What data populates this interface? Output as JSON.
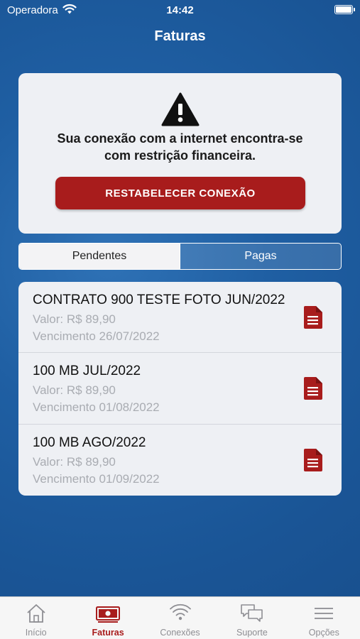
{
  "status_bar": {
    "carrier": "Operadora",
    "time": "14:42"
  },
  "nav": {
    "title": "Faturas"
  },
  "alert": {
    "icon": "warning-icon",
    "line1": "Sua conexão com a internet encontra-se",
    "line2": "com restrição financeira.",
    "button_label": "RESTABELECER CONEXÃO"
  },
  "segments": {
    "pending": "Pendentes",
    "paid": "Pagas",
    "selected": "Pendentes"
  },
  "invoices": [
    {
      "title": "CONTRATO 900 TESTE FOTO JUN/2022",
      "value": "Valor: R$ 89,90",
      "due": "Vencimento 26/07/2022"
    },
    {
      "title": "100 MB JUL/2022",
      "value": "Valor: R$ 89,90",
      "due": "Vencimento 01/08/2022"
    },
    {
      "title": "100 MB AGO/2022",
      "value": "Valor: R$ 89,90",
      "due": "Vencimento 01/09/2022"
    }
  ],
  "tabs": [
    {
      "label": "Início",
      "icon": "home-icon"
    },
    {
      "label": "Faturas",
      "icon": "bill-icon"
    },
    {
      "label": "Conexões",
      "icon": "wifi-icon"
    },
    {
      "label": "Suporte",
      "icon": "chat-icon"
    },
    {
      "label": "Opções",
      "icon": "menu-icon"
    }
  ],
  "colors": {
    "accent": "#a81c1c",
    "background": "#1f5fa3",
    "card": "#eef0f4",
    "inactive_tab": "#8e8e93"
  }
}
